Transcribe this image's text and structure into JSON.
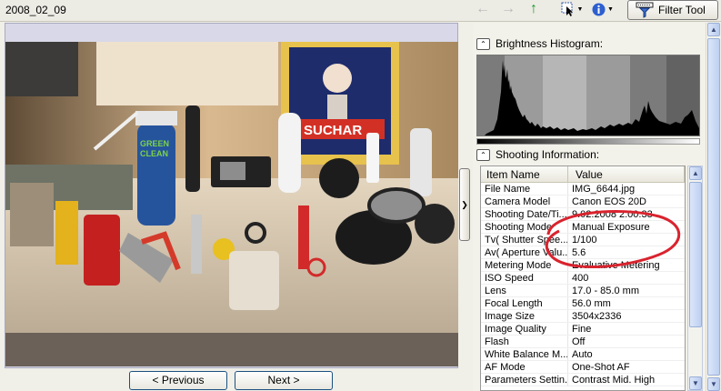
{
  "toolbar": {
    "folder_title": "2008_02_09",
    "filter_label": "Filter Tool"
  },
  "navigation": {
    "previous_label": "< Previous",
    "next_label": "Next >"
  },
  "panel": {
    "histogram_title": "Brightness Histogram:",
    "shooting_title": "Shooting Information:",
    "columns": {
      "name": "Item Name",
      "value": "Value"
    },
    "rows": [
      {
        "name": "File Name",
        "value": "IMG_6644.jpg"
      },
      {
        "name": "Camera Model",
        "value": "Canon EOS 20D"
      },
      {
        "name": "Shooting Date/Ti...",
        "value": "9.02.2008 2:00:33"
      },
      {
        "name": "Shooting Mode",
        "value": "Manual Exposure"
      },
      {
        "name": "Tv( Shutter Spee...",
        "value": "1/100"
      },
      {
        "name": "Av( Aperture Valu...",
        "value": "5.6"
      },
      {
        "name": "Metering Mode",
        "value": "Evaluative Metering"
      },
      {
        "name": "ISO Speed",
        "value": "400"
      },
      {
        "name": "Lens",
        "value": "17.0 - 85.0 mm"
      },
      {
        "name": "Focal Length",
        "value": "56.0 mm"
      },
      {
        "name": "Image Size",
        "value": "3504x2336"
      },
      {
        "name": "Image Quality",
        "value": "Fine"
      },
      {
        "name": "Flash",
        "value": "Off"
      },
      {
        "name": "White Balance M...",
        "value": "Auto"
      },
      {
        "name": "AF Mode",
        "value": "One-Shot AF"
      },
      {
        "name": "Parameters Settin...",
        "value": "Contrast  Mid. High"
      }
    ]
  },
  "colors": {
    "annotation": "#d9232e",
    "histogram_bars": "#000000"
  }
}
